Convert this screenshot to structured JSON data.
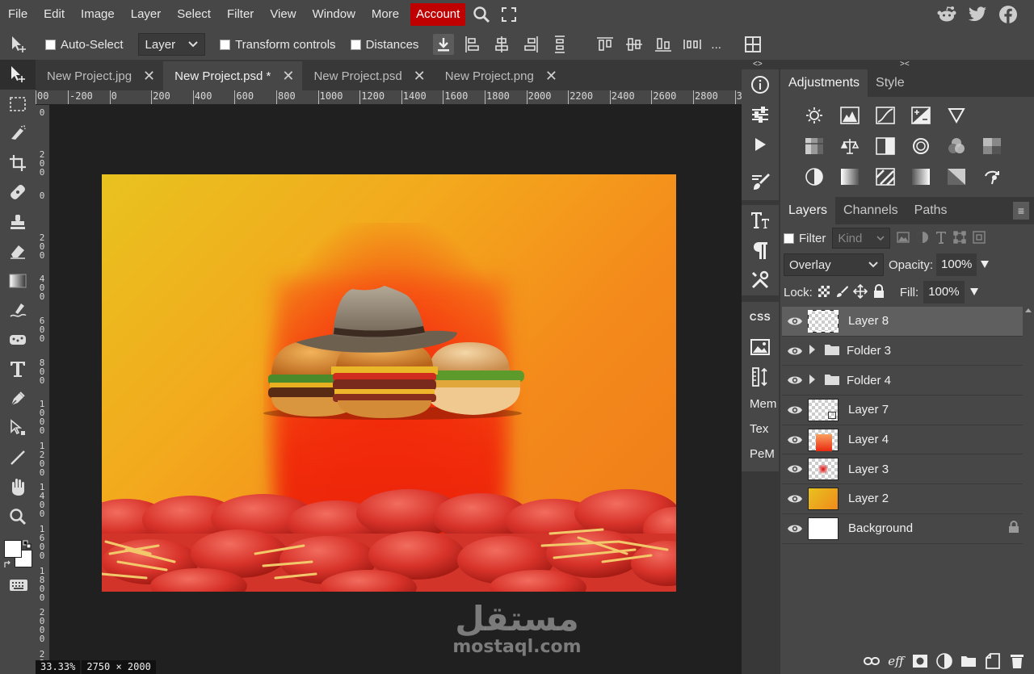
{
  "menu": {
    "items": [
      "File",
      "Edit",
      "Image",
      "Layer",
      "Select",
      "Filter",
      "View",
      "Window",
      "More"
    ],
    "account": "Account"
  },
  "options": {
    "auto_select": "Auto-Select",
    "layer_select": "Layer",
    "transform_controls": "Transform controls",
    "distances": "Distances",
    "more": "..."
  },
  "tabs": [
    {
      "label": "New Project.jpg",
      "active": false
    },
    {
      "label": "New Project.psd *",
      "active": true
    },
    {
      "label": "New Project.psd",
      "active": false
    },
    {
      "label": "New Project.png",
      "active": false
    }
  ],
  "ruler": {
    "top_labels": [
      "00",
      "-200",
      "0",
      "200",
      "400",
      "600",
      "800",
      "1000",
      "1200",
      "1400",
      "1600",
      "1800",
      "2000",
      "2200",
      "2400",
      "2600",
      "2800",
      "30"
    ],
    "left_labels": [
      "0",
      "200",
      "0",
      "200",
      "400",
      "600",
      "800",
      "1000",
      "1200",
      "1400",
      "1600",
      "1800",
      "2000",
      "2200"
    ]
  },
  "status": {
    "zoom": "33.33%",
    "size": "2750 × 2000"
  },
  "watermark": {
    "arabic": "مستقل",
    "latin": "mostaql.com"
  },
  "side_text": [
    "CSS",
    "Mem",
    "Tex",
    "PeM"
  ],
  "adjustments": {
    "tabs": [
      "Adjustments",
      "Style"
    ]
  },
  "layers_panel": {
    "tabs": [
      "Layers",
      "Channels",
      "Paths"
    ],
    "filter_label": "Filter",
    "kind": "Kind",
    "blend_mode": "Overlay",
    "opacity_label": "Opacity:",
    "opacity": "100%",
    "lock_label": "Lock:",
    "fill_label": "Fill:",
    "fill": "100%",
    "layers": [
      {
        "name": "Layer 8",
        "type": "layer",
        "selected": true,
        "thumb": "checker-sel"
      },
      {
        "name": "Folder 3",
        "type": "folder"
      },
      {
        "name": "Folder 4",
        "type": "folder"
      },
      {
        "name": "Layer 7",
        "type": "layer",
        "thumb": "checker"
      },
      {
        "name": "Layer 4",
        "type": "layer",
        "thumb": "beam"
      },
      {
        "name": "Layer 3",
        "type": "layer",
        "thumb": "dot"
      },
      {
        "name": "Layer 2",
        "type": "layer",
        "thumb": "gradient"
      },
      {
        "name": "Background",
        "type": "layer",
        "thumb": "white",
        "locked": true
      }
    ]
  },
  "colors": {
    "account_red": "#c00000",
    "panel_bg": "#474747",
    "canvas_bg": "#202020"
  }
}
